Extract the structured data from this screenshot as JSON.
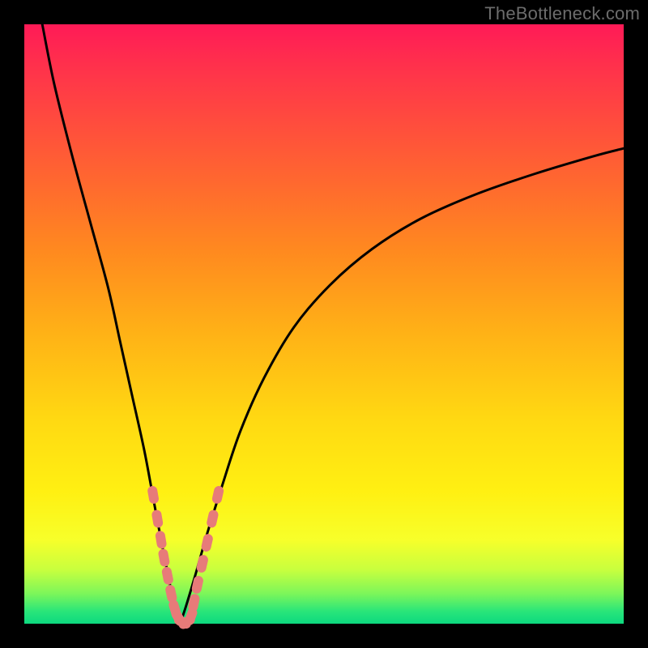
{
  "watermark": "TheBottleneck.com",
  "colors": {
    "frame": "#000000",
    "curve": "#000000",
    "marker": "#e77b79",
    "gradient_top": "#ff1a57",
    "gradient_bottom": "#0dd97f"
  },
  "chart_data": {
    "type": "line",
    "title": "",
    "xlabel": "",
    "ylabel": "",
    "xlim": [
      0,
      100
    ],
    "ylim": [
      0,
      100
    ],
    "note": "Axes are unlabeled in the image; values below are estimated from pixel positions on a 0–100 normalized scale.",
    "series": [
      {
        "name": "left-branch",
        "x": [
          3,
          5,
          8,
          11,
          14,
          16,
          18,
          20,
          21.5,
          23,
          24.3,
          25.2,
          26
        ],
        "values": [
          100,
          90,
          78,
          67,
          56,
          47,
          38,
          29,
          21,
          13,
          6.5,
          2.5,
          0
        ]
      },
      {
        "name": "right-branch",
        "x": [
          26,
          27,
          28.5,
          30.5,
          33,
          36,
          40,
          45,
          51,
          58,
          66,
          75,
          85,
          95,
          100
        ],
        "values": [
          0,
          3,
          8,
          15,
          23,
          32,
          41,
          49.5,
          56.5,
          62.5,
          67.5,
          71.5,
          75,
          78,
          79.3
        ]
      }
    ],
    "markers": {
      "name": "highlighted-points",
      "note": "Pink segment markers clustered near the curve minimum.",
      "points": [
        {
          "x": 21.5,
          "y": 21.5
        },
        {
          "x": 22.2,
          "y": 17.5
        },
        {
          "x": 22.8,
          "y": 14.0
        },
        {
          "x": 23.3,
          "y": 11.0
        },
        {
          "x": 23.9,
          "y": 8.0
        },
        {
          "x": 24.5,
          "y": 5.0
        },
        {
          "x": 25.1,
          "y": 2.5
        },
        {
          "x": 25.7,
          "y": 1.0
        },
        {
          "x": 26.4,
          "y": 0.3
        },
        {
          "x": 27.1,
          "y": 0.3
        },
        {
          "x": 27.8,
          "y": 1.2
        },
        {
          "x": 28.3,
          "y": 3.5
        },
        {
          "x": 28.9,
          "y": 6.5
        },
        {
          "x": 29.7,
          "y": 10.0
        },
        {
          "x": 30.5,
          "y": 13.5
        },
        {
          "x": 31.4,
          "y": 17.5
        },
        {
          "x": 32.3,
          "y": 21.5
        }
      ]
    }
  }
}
